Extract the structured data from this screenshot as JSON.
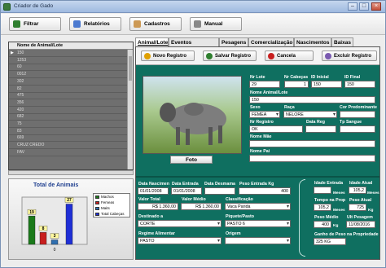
{
  "window": {
    "title": "Criador de Gado"
  },
  "toolbar": {
    "filtrar": "Filtrar",
    "relatorios": "Relatórios",
    "cadastros": "Cadastros",
    "manual": "Manual"
  },
  "grid": {
    "header": "Nome de Animal/Lote",
    "rows": [
      "150",
      "1253",
      "60",
      "0012",
      "302",
      "82",
      "475",
      "356",
      "420",
      "682",
      "75",
      "83",
      "669",
      "CRUZ CREDO",
      "FAV"
    ]
  },
  "chart_data": {
    "type": "bar",
    "title": "Total de Animais",
    "categories": [
      "Machos",
      "Femeas",
      "Maits",
      "Total Cabeças"
    ],
    "values": [
      19,
      8,
      3,
      27
    ],
    "colors": [
      "#1a7a1a",
      "#c81e1e",
      "#2f6fb0",
      "#1f2fd6"
    ],
    "ylim": [
      0,
      30
    ],
    "xtick": "0"
  },
  "tabs": [
    "Animal/Lote",
    "Eventos Sanitários",
    "Pesagens",
    "Comercialização",
    "Nascimentos",
    "Baixas"
  ],
  "actions": {
    "novo": "Novo Registro",
    "salvar": "Salvar Registro",
    "cancela": "Cancela",
    "excluir": "Excluir Registro"
  },
  "photo_button": "Foto",
  "form": {
    "nr_lote": {
      "label": "Nr Lote",
      "value": "29"
    },
    "nr_cabecas": {
      "label": "Nr Cabeças",
      "value": "1"
    },
    "id_inicial": {
      "label": "ID Inicial",
      "value": "150"
    },
    "id_final": {
      "label": "ID Final",
      "value": "150"
    },
    "nome": {
      "label": "Nome Animal/Lote",
      "value": "150"
    },
    "sexo": {
      "label": "Sexo",
      "value": "FEMEA"
    },
    "raca": {
      "label": "Raça",
      "value": "NELORE"
    },
    "cor": {
      "label": "Cor Predominante",
      "value": ""
    },
    "nr_registro": {
      "label": "Nr Registro",
      "value": "OK"
    },
    "data_reg": {
      "label": "Data Reg",
      "value": ""
    },
    "tp_sangue": {
      "label": "Tp Sangue",
      "value": ""
    },
    "nome_mae": {
      "label": "Nome Mãe",
      "value": ""
    },
    "nome_pai": {
      "label": "Nome Pai",
      "value": ""
    },
    "data_nasc": {
      "label": "Data Nascimen",
      "value": "01/01/2008"
    },
    "data_entrada": {
      "label": "Data Entrada",
      "value": "01/01/2008"
    },
    "data_desmama": {
      "label": "Data Desmama",
      "value": ""
    },
    "peso_entrada": {
      "label": "Peso Entrada Kg",
      "value": "400"
    },
    "valor_total": {
      "label": "Valor Total",
      "value": "R$ 1.360,00"
    },
    "valor_medio": {
      "label": "Valor Médio",
      "value": "R$ 1.360,00"
    },
    "classificacao": {
      "label": "Classificação",
      "value": "Vaca Parida"
    },
    "destinado": {
      "label": "Destinado a",
      "value": "CORTE"
    },
    "piquete": {
      "label": "Piquete/Pasto",
      "value": "PASTO 6"
    },
    "regime": {
      "label": "Regime Alimentar",
      "value": "PASTO"
    },
    "origem": {
      "label": "Origem",
      "value": ""
    },
    "idade_entrada": {
      "label": "Idade Entrada",
      "value": "",
      "unit": "Meses"
    },
    "idade_atual": {
      "label": "Idade Atual",
      "value": "105,2",
      "unit": "Meses"
    },
    "tempo_prop": {
      "label": "Tempo na Prop",
      "value": "105,2",
      "unit": "Meses"
    },
    "peso_atual": {
      "label": "Peso Atual",
      "value": "725",
      "unit": "Kg"
    },
    "peso_medio": {
      "label": "Peso Médio",
      "value": "400",
      "unit": "Kg"
    },
    "ult_pesagem": {
      "label": "Ult Pesagem",
      "value": "11/08/2016"
    },
    "ganho": {
      "label": "Ganho de Peso na Propriedade",
      "value": "325 KG"
    }
  }
}
